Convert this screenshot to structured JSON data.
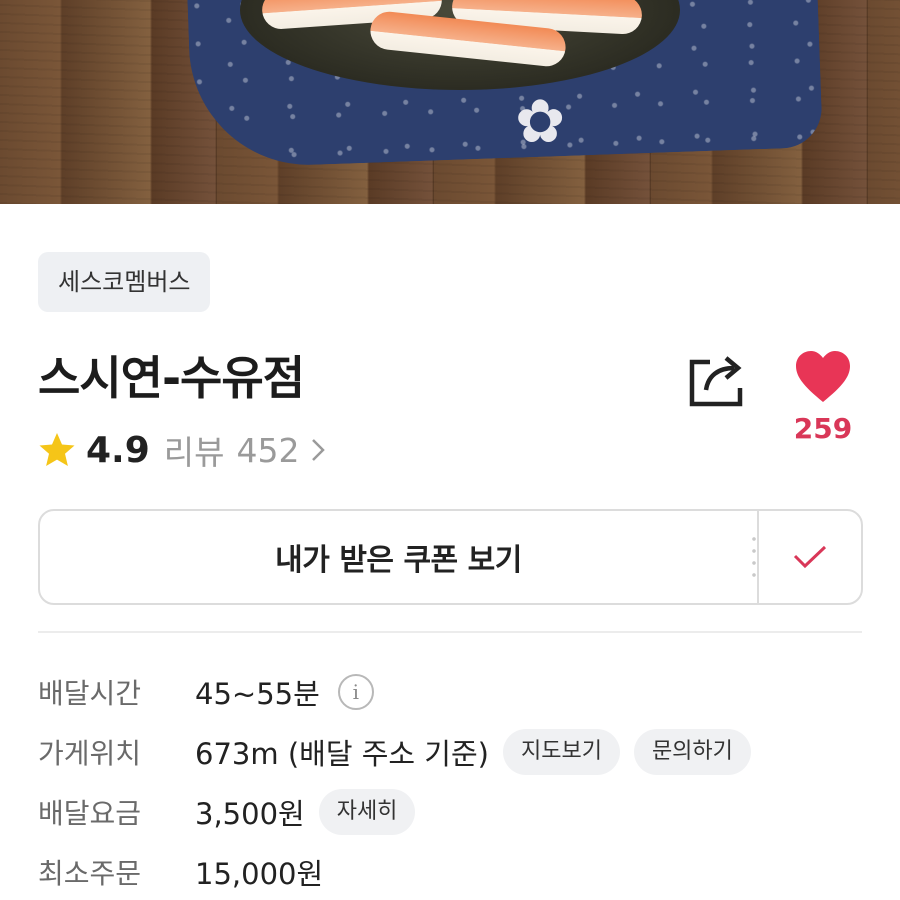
{
  "hero": {
    "photo_icon": "sushi-photo"
  },
  "store": {
    "category": "세스코멤버스",
    "name": "스시연-수유점",
    "rating": "4.9",
    "review_label": "리뷰",
    "review_count": "452",
    "like_count": "259"
  },
  "coupon": {
    "button_label": "내가 받은 쿠폰 보기",
    "check_icon": "check-icon"
  },
  "info": {
    "delivery_time": {
      "label": "배달시간",
      "value": "45~55분",
      "icon": "info-icon",
      "icon_glyph": "i"
    },
    "location": {
      "label": "가게위치",
      "value": "673m (배달 주소 기준)",
      "map_button": "지도보기",
      "inquiry_button": "문의하기"
    },
    "delivery_fee": {
      "label": "배달요금",
      "value": "3,500원",
      "detail_button": "자세히"
    },
    "min_order": {
      "label": "최소주문",
      "value": "15,000원"
    }
  },
  "colors": {
    "accent": "#d93758",
    "star": "#f5c518",
    "chip_bg": "#eef0f3"
  }
}
